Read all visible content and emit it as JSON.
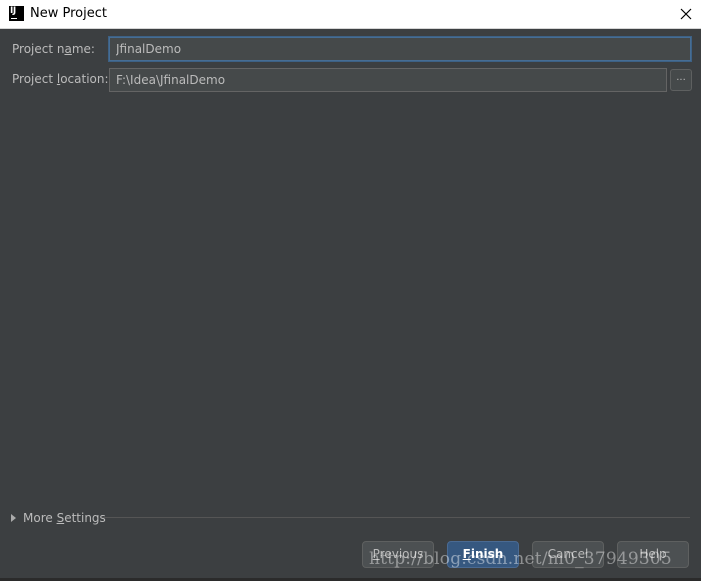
{
  "window": {
    "title": "New Project",
    "logo_text": "IJ"
  },
  "form": {
    "name_label_before": "Project n",
    "name_label_mnemonic": "a",
    "name_label_after": "me:",
    "name_value": "JfinalDemo",
    "location_label_before": "Project ",
    "location_label_mnemonic": "l",
    "location_label_after": "ocation:",
    "location_value": "F:\\Idea\\JfinalDemo",
    "browse_label": "..."
  },
  "more_settings": {
    "label_before": "More ",
    "label_mnemonic": "S",
    "label_after": "ettings"
  },
  "buttons": {
    "previous_mnemonic": "P",
    "previous_rest": "revious",
    "finish_mnemonic": "F",
    "finish_rest": "inish",
    "cancel": "Cancel",
    "help": "Help"
  },
  "watermark": "http://blog.csdn.net/m0_37949305"
}
